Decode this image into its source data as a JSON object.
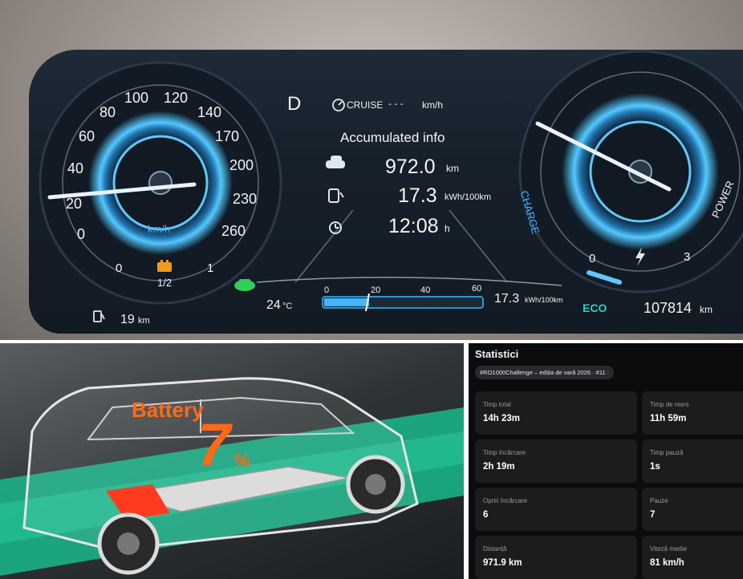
{
  "cluster": {
    "gear": "D",
    "cruise_label": "CRUISE",
    "cruise_value": "- - -",
    "cruise_unit": "km/h",
    "info_title": "Accumulated info",
    "distance_value": "972.0",
    "distance_unit": "km",
    "consumption_value": "17.3",
    "consumption_unit": "kWh/100km",
    "time_value": "12:08",
    "time_unit": "h",
    "speed_unit": "km/h",
    "speed_ticks": [
      "0",
      "20",
      "40",
      "60",
      "80",
      "100",
      "120",
      "140",
      "170",
      "200",
      "230",
      "260"
    ],
    "battery_gauge_left": "0",
    "battery_gauge_mid": "1/2",
    "battery_gauge_right": "1",
    "range_value": "19",
    "range_unit": "km",
    "temperature": "24",
    "temperature_unit": "°C",
    "bar_ticks": [
      "0",
      "20",
      "40",
      "60"
    ],
    "bar_value": "17.3",
    "bar_unit": "kWh/100km",
    "eco_label": "ECO",
    "odometer_value": "107814",
    "odometer_unit": "km",
    "charge_label": "CHARGE",
    "power_label": "POWER",
    "power_gauge_left": "0",
    "power_gauge_right": "3",
    "accent_color": "#3fb6ff",
    "eco_color": "#2ad1c4"
  },
  "battery_screen": {
    "label": "Battery",
    "percent_value": "7",
    "percent_sign": "%",
    "accent_color": "#ff6a18"
  },
  "stats": {
    "title": "Statistici",
    "challenge_tag": "#RO1000Challenge – ediția de vară 2026 · #11 ·",
    "cards": [
      {
        "label": "Timp total",
        "value": "14h 23m"
      },
      {
        "label": "Timp de mers",
        "value": "11h 59m"
      },
      {
        "label": "Timp încărcare",
        "value": "2h 19m"
      },
      {
        "label": "Timp pauză",
        "value": "1s"
      },
      {
        "label": "Opriri încărcare",
        "value": "6"
      },
      {
        "label": "Pauze",
        "value": "7"
      },
      {
        "label": "Distanță",
        "value": "971.9 km"
      },
      {
        "label": "Viteză medie",
        "value": "81 km/h"
      }
    ]
  }
}
